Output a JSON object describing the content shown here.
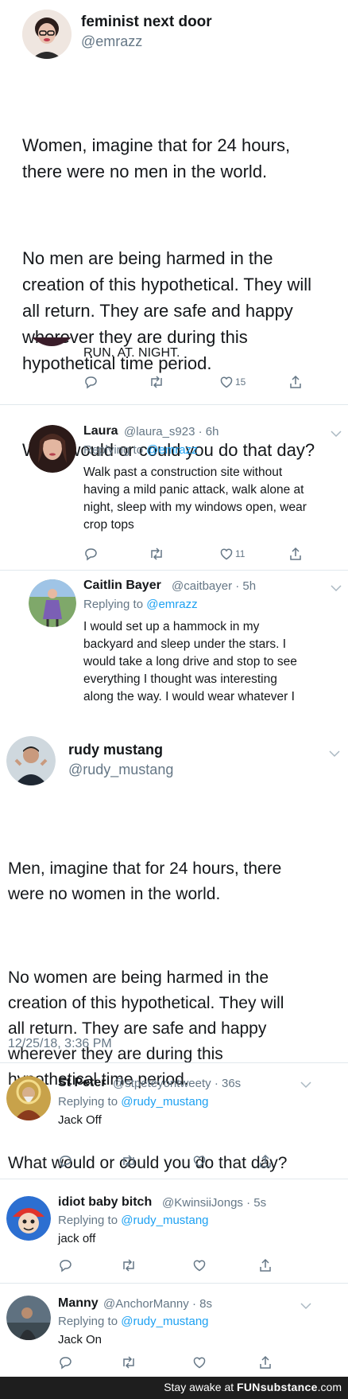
{
  "tweet1": {
    "name": "feminist next door",
    "handle": "@emrazz",
    "paragraphs": [
      "Women, imagine that for 24 hours,\nthere were no men in the world.",
      "No men are being harmed in the\ncreation of this hypothetical. They will\nall return. They are safe and happy\nwherever they are during this\nhypothetical time period.",
      "What would or could you do that day?"
    ]
  },
  "reply0": {
    "text": "RUN. AT. NIGHT.",
    "likes": "15"
  },
  "reply1": {
    "name": "Laura",
    "handle": "@laura_s923",
    "time": "· 6h",
    "replying_label": "Replying to ",
    "replying_to": "@emrazz",
    "text": "Walk past a construction site without\nhaving a mild panic attack, walk alone at\nnight, sleep with my windows open, wear\ncrop tops",
    "likes": "11"
  },
  "reply2": {
    "name": "Caitlin Bayer",
    "handle": "@caitbayer",
    "time": "· 5h",
    "replying_label": "Replying to ",
    "replying_to": "@emrazz",
    "text": "I would set up a hammock in my\nbackyard and sleep under the stars. I\nwould take a long drive and stop to see\neverything I thought was interesting\nalong the way. I would wear whatever I"
  },
  "tweet2": {
    "name": "rudy mustang",
    "handle": "@rudy_mustang",
    "paragraphs": [
      "Men, imagine that for 24 hours, there\nwere no women in the world.",
      "No women are being harmed in the\ncreation of this hypothetical. They will\nall return. They are safe and happy\nwherever they are during this\nhypothetical time period.",
      "What would or could you do that day?"
    ],
    "timestamp": "12/25/18, 3:36 PM"
  },
  "reply3": {
    "name": "St Peter",
    "handle": "@stpeteyontweety",
    "time": "· 36s",
    "replying_label": "Replying to ",
    "replying_to": "@rudy_mustang",
    "text": "Jack Off"
  },
  "reply4": {
    "name": "idiot baby bitch",
    "handle": "@KwinsiiJongs",
    "time": "· 5s",
    "replying_label": "Replying to ",
    "replying_to": "@rudy_mustang",
    "text": "jack off"
  },
  "reply5": {
    "name": "Manny",
    "handle": "@AnchorManny",
    "time": "· 8s",
    "replying_label": "Replying to ",
    "replying_to": "@rudy_mustang",
    "text": "Jack On"
  },
  "footer": {
    "prefix": "Stay awake at ",
    "brand": "FUNsubstance",
    "suffix": ".com"
  },
  "colors": {
    "link": "#1da1f2",
    "secondary_text": "#657786",
    "primary_text": "#14171a",
    "footer_bg": "#1e1e1e"
  },
  "icons": [
    "reply-icon",
    "retweet-icon",
    "like-icon",
    "share-icon",
    "chevron-down-icon"
  ]
}
